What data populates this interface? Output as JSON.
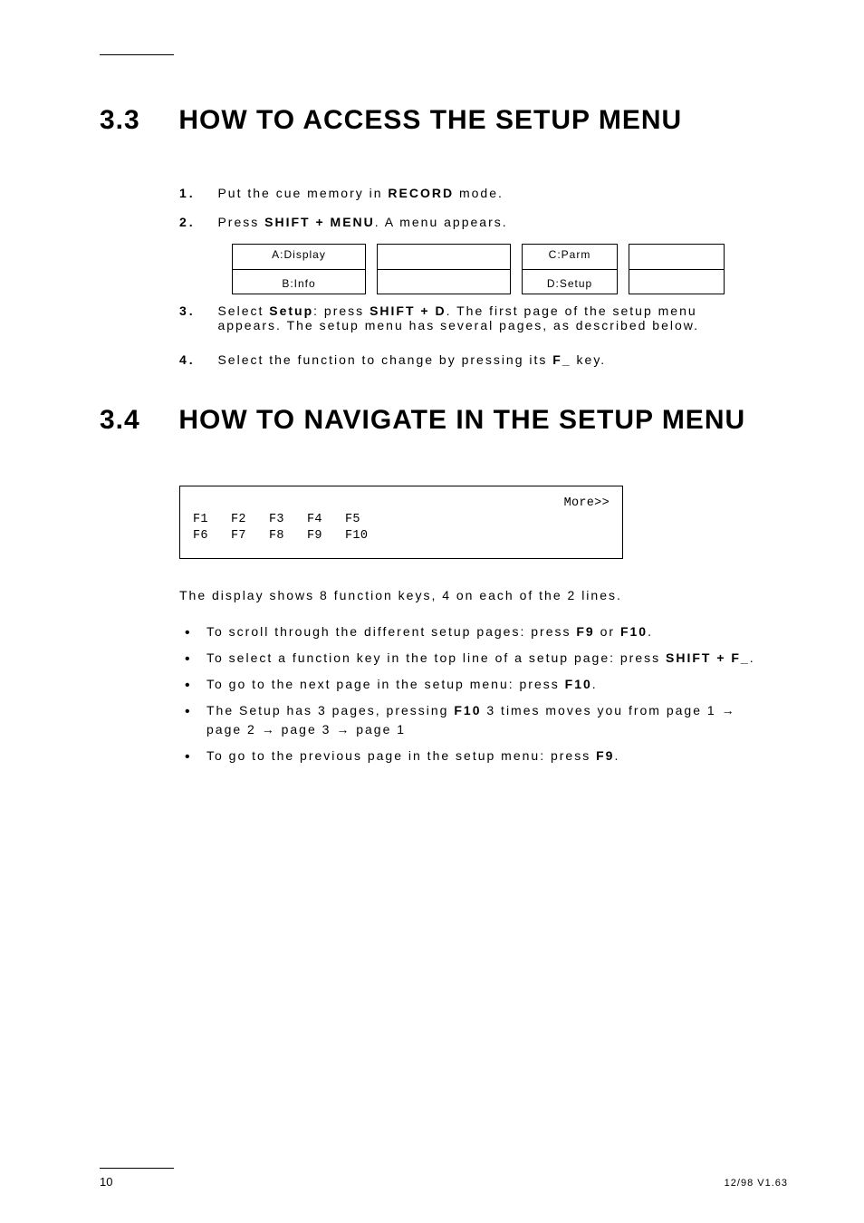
{
  "section33": {
    "num": "3.3",
    "title": "HOW TO ACCESS THE SETUP MENU",
    "steps": [
      {
        "n": "1.",
        "pre": "Put the cue memory in ",
        "bold": "RECORD",
        "post": " mode."
      },
      {
        "n": "2.",
        "pre": "Press ",
        "bold": "SHIFT + MENU",
        "post": ". A menu appears."
      },
      {
        "n": "3.",
        "pre": "Select ",
        "bold": "Setup",
        "postpre": ": press ",
        "bold2": "SHIFT + D",
        "post2": ". The first page of the setup menu appears. The setup menu has several pages, as described below."
      },
      {
        "n": "4.",
        "pre": "Select the function to change by pressing its ",
        "bold": "F_",
        "post": " key."
      }
    ]
  },
  "menu_boxes": [
    {
      "top": "A:Display",
      "bot": "B:Info"
    },
    {
      "top": "",
      "bot": ""
    },
    {
      "top": "C:Parm",
      "bot": "D:Setup"
    },
    {
      "top": "",
      "bot": ""
    }
  ],
  "section34": {
    "num": "3.4",
    "title": "HOW TO NAVIGATE IN THE SETUP MENU"
  },
  "nav_fig": {
    "lines": [
      "More>>",
      "F1   F2   F3   F4   F5",
      "",
      "F6   F7   F8   F9   F10"
    ]
  },
  "nav_caption": "The display shows 8 function keys, 4 on each of the 2 lines.",
  "bullets": [
    {
      "text_parts": [
        "To scroll through the different setup pages: press ",
        {
          "b": "F9"
        },
        " or ",
        {
          "b": "F10"
        },
        "."
      ]
    },
    {
      "text_parts": [
        "To select a function key in the top line of a setup page: press ",
        {
          "b": "SHIFT + F_"
        },
        "."
      ]
    },
    {
      "text_parts": [
        "To go to the next page in the setup menu: press ",
        {
          "b": "F10"
        },
        "."
      ]
    },
    {
      "text_parts": [
        "The Setup has 3 pages, pressing ",
        {
          "b": "F10"
        },
        " 3 times moves you from page 1 ",
        {
          "a": "→"
        },
        " page 2 ",
        {
          "a": "→"
        },
        " page 3 ",
        {
          "a": "→"
        },
        " page 1"
      ]
    },
    {
      "text_parts": [
        "To go to the previous page in the setup menu: press ",
        {
          "b": "F9"
        },
        "."
      ]
    }
  ],
  "footer": {
    "left_page": "10",
    "right_label": "12/98 V1.63"
  }
}
